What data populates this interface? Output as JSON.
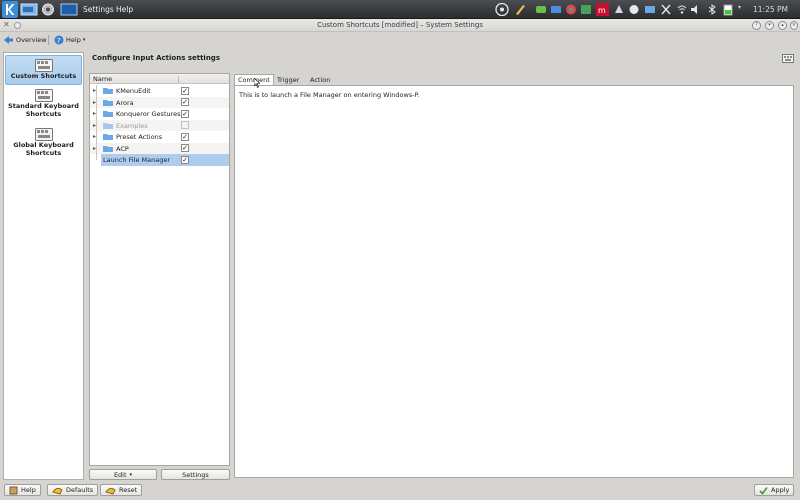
{
  "panel": {
    "menus": [
      "Settings",
      "Help"
    ],
    "clock": "11:25 PM"
  },
  "window": {
    "title": "Custom Shortcuts [modified] – System Settings"
  },
  "toolbar": {
    "overview_label": "Overview",
    "help_label": "Help"
  },
  "sidebar": {
    "items": [
      {
        "label": "Custom Shortcuts",
        "active": true
      },
      {
        "label": "Standard Keyboard Shortcuts",
        "active": false
      },
      {
        "label": "Global Keyboard Shortcuts",
        "active": false
      }
    ]
  },
  "main": {
    "heading": "Configure Input Actions settings"
  },
  "tree": {
    "column_name": "Name",
    "rows": [
      {
        "label": "KMenuEdit",
        "checked": true,
        "group": true
      },
      {
        "label": "Arora",
        "checked": true,
        "group": true
      },
      {
        "label": "Konqueror Gestures",
        "checked": true,
        "group": true
      },
      {
        "label": "Examples",
        "checked": false,
        "group": true
      },
      {
        "label": "Preset Actions",
        "checked": true,
        "group": true
      },
      {
        "label": "ACP",
        "checked": true,
        "group": true
      },
      {
        "label": "Launch File Manager",
        "checked": true,
        "group": false
      }
    ],
    "edit_button": "Edit",
    "settings_button": "Settings"
  },
  "tabs": {
    "items": [
      "Comment",
      "Trigger",
      "Action"
    ],
    "active_index": 0,
    "comment_text": "This is to launch a File Manager on entering Windows-P."
  },
  "footer": {
    "help_label": "Help",
    "defaults_label": "Defaults",
    "reset_label": "Reset",
    "apply_label": "Apply"
  },
  "colors": {
    "selection": "#aecdee",
    "panel_dark": "#2b2d30",
    "window_bg": "#d6d4d1"
  }
}
